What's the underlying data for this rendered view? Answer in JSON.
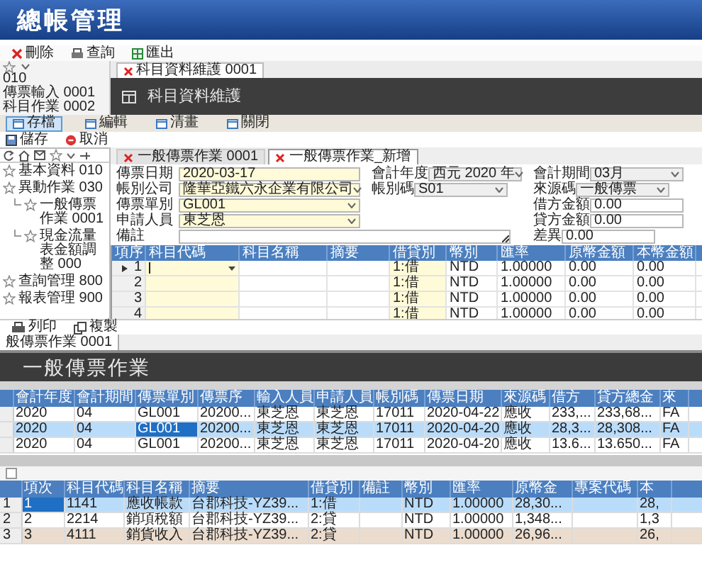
{
  "header": {
    "title": "總帳管理"
  },
  "back_window": {
    "toolbar": [
      {
        "label": "刪除",
        "kind": "delete"
      },
      {
        "label": "查詢",
        "kind": "query"
      },
      {
        "label": "匯出",
        "kind": "export"
      }
    ],
    "side_list": [
      "010",
      "傳票輸入 0001",
      "科目作業 0002"
    ],
    "tabs": [
      {
        "label": "科目資料維護 0001",
        "selected": true
      }
    ],
    "banner": "科目資料維護",
    "actions": [
      {
        "label": "存檔",
        "selected": true
      },
      {
        "label": "編輯",
        "selected": false
      },
      {
        "label": "清畫",
        "selected": false
      },
      {
        "label": "關閉",
        "selected": false
      }
    ],
    "edit_actions": [
      {
        "label": "儲存",
        "kind": "save"
      },
      {
        "label": "取消",
        "kind": "cancel"
      }
    ],
    "tree": [
      {
        "label": "基本資料 010"
      },
      {
        "label": "異動作業 030",
        "children": [
          {
            "label": "一般傳票作業 0001"
          },
          {
            "label": "現金流量表金額調整 000"
          }
        ]
      },
      {
        "label": "查詢管理 800"
      },
      {
        "label": "報表管理 900"
      }
    ],
    "form_tabs": [
      {
        "label": "一般傳票作業 0001",
        "selected": false
      },
      {
        "label": "一般傳票作業_新增",
        "selected": true
      }
    ],
    "form": {
      "column_1": [
        {
          "label": "傳票日期",
          "value": "2020-03-17",
          "kind": "text",
          "color": "#fffbd8"
        },
        {
          "label": "帳別公司",
          "value": "隆華亞鐵六永企業有限公司",
          "kind": "dropdown",
          "color": "#fffbd8"
        },
        {
          "label": "傳票單別",
          "value": "GL001",
          "kind": "dropdown",
          "color": "#fffbd8"
        },
        {
          "label": "申請人員",
          "value": "東芝恩",
          "kind": "dropdown",
          "color": "#fffbd8"
        }
      ],
      "column_2": [
        {
          "label": "會計年度",
          "value": "西元 2020 年",
          "kind": "dropdown",
          "color": "#efefef"
        },
        {
          "label": "帳別碼",
          "value": "S01",
          "kind": "dropdown",
          "color": "#efefef"
        }
      ],
      "column_3": [
        {
          "label": "會計期間",
          "value": "03月",
          "kind": "dropdown",
          "color": "#efefef"
        },
        {
          "label": "來源碼",
          "value": "一般傳票",
          "kind": "dropdown",
          "color": "#efefef"
        },
        {
          "label": "借方金額",
          "value": "0.00",
          "kind": "text",
          "color": "#ffffff"
        },
        {
          "label": "貸方金額",
          "value": "0.00",
          "kind": "text",
          "color": "#ffffff"
        },
        {
          "label": "差異",
          "value": "0.00",
          "kind": "text",
          "color": "#ffffff"
        }
      ],
      "remark": {
        "label": "備註"
      }
    },
    "grid": {
      "columns": [
        {
          "label": "項序",
          "required": false
        },
        {
          "label": "科目代碼",
          "required": true
        },
        {
          "label": "科目名稱",
          "required": false
        },
        {
          "label": "摘要",
          "required": false
        },
        {
          "label": "借貸別",
          "required": true
        },
        {
          "label": "幣別",
          "required": false
        },
        {
          "label": "匯率",
          "required": false
        },
        {
          "label": "原幣金額",
          "required": false
        },
        {
          "label": "本幣金額",
          "required": false
        }
      ],
      "rows": [
        {
          "current": true,
          "cells": [
            "1",
            null,
            null,
            null,
            "1:借",
            "NTD",
            "1.00000",
            "0.00",
            "0.00"
          ]
        },
        {
          "current": false,
          "cells": [
            "2",
            null,
            null,
            null,
            "1:借",
            "NTD",
            "1.00000",
            "0.00",
            "0.00"
          ]
        },
        {
          "current": false,
          "cells": [
            "3",
            null,
            null,
            null,
            "1:借",
            "NTD",
            "1.00000",
            "0.00",
            "0.00"
          ]
        },
        {
          "current": false,
          "cells": [
            "4",
            null,
            null,
            null,
            "1:借",
            "NTD",
            "1.00000",
            "0.00",
            "0.00"
          ]
        }
      ]
    },
    "bottom_toolbar": [
      {
        "label": "列印",
        "kind": "print"
      },
      {
        "label": "複製",
        "kind": "copy"
      }
    ]
  },
  "front_window": {
    "tabs": [
      {
        "label": "般傳票作業 0001",
        "selected": true
      }
    ],
    "banner": "一般傳票作業",
    "master_grid": {
      "columns": [
        "會計年度",
        "會計期間",
        "傳票單別",
        "傳票序",
        "輸入人員",
        "申請人員",
        "帳別碼",
        "傳票日期",
        "來源碼",
        "借方",
        "貸方總金",
        "來"
      ],
      "rows": [
        {
          "selected": false,
          "focused": [
            false,
            false,
            false,
            false,
            false,
            false,
            false,
            false,
            false,
            false,
            false,
            false
          ],
          "cells": [
            "2020",
            "04",
            "GL001",
            "20200...",
            "東芝恩",
            "東芝恩",
            "17011",
            "2020-04-22",
            "應收",
            "233,...",
            "233,68...",
            "FA"
          ]
        },
        {
          "selected": true,
          "focused": [
            false,
            false,
            true,
            false,
            false,
            false,
            false,
            false,
            false,
            false,
            false,
            false
          ],
          "cells": [
            "2020",
            "04",
            "GL001",
            "20200...",
            "東芝恩",
            "東芝恩",
            "17011",
            "2020-04-20",
            "應收",
            "28,3...",
            "28,308...",
            "FA"
          ]
        },
        {
          "selected": false,
          "focused": [
            false,
            false,
            false,
            false,
            false,
            false,
            false,
            false,
            false,
            false,
            false,
            false
          ],
          "cells": [
            "2020",
            "04",
            "GL001",
            "20200...",
            "東芝恩",
            "東芝恩",
            "17011",
            "2020-04-20",
            "應收",
            "13.6...",
            "13.650...",
            "FA"
          ]
        }
      ]
    },
    "detail_grid": {
      "columns": [
        "項次",
        "科目代碼",
        "科目名稱",
        "摘要",
        "借貸別",
        "備註",
        "幣別",
        "匯率",
        "原幣金",
        "專案代碼",
        "本"
      ],
      "rows": [
        {
          "number": "1",
          "selected": true,
          "marked": false,
          "focused": [
            true,
            false,
            false,
            false,
            false,
            false,
            false,
            false,
            false,
            false,
            false
          ],
          "cells": [
            "1",
            "1141",
            "應收帳款",
            "台郡科技-YZ39...",
            "1:借",
            null,
            "NTD",
            "1.00000",
            "28,30...",
            null,
            "28,"
          ]
        },
        {
          "number": "2",
          "selected": false,
          "marked": false,
          "focused": [
            false,
            false,
            false,
            false,
            false,
            false,
            false,
            false,
            false,
            false,
            false
          ],
          "cells": [
            "2",
            "2214",
            "銷項稅額",
            "台郡科技-YZ39...",
            "2:貸",
            null,
            "NTD",
            "1.00000",
            "1,348...",
            null,
            "1,3"
          ]
        },
        {
          "number": "3",
          "selected": false,
          "marked": true,
          "focused": [
            false,
            false,
            false,
            false,
            false,
            false,
            false,
            false,
            false,
            false,
            false
          ],
          "cells": [
            "3",
            "4111",
            "銷貨收入",
            "台郡科技-YZ39...",
            "2:貸",
            null,
            "NTD",
            "1.00000",
            "26,96...",
            null,
            "26,"
          ]
        }
      ]
    }
  }
}
